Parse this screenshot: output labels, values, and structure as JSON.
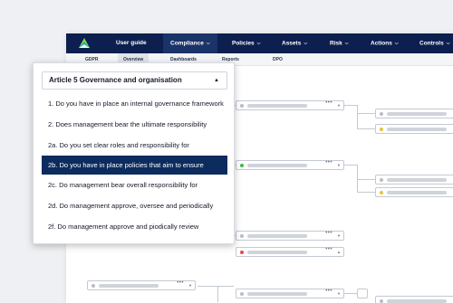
{
  "brand": {
    "logo_icon": "triangle-logo-icon",
    "colors": {
      "navbar": "#0c1f4e",
      "selected": "#0c2b5e",
      "green": "#3fb950",
      "yellow": "#e8c33a",
      "red": "#e5484d"
    }
  },
  "nav": {
    "items": [
      {
        "label": "User guide"
      },
      {
        "label": "Compliance"
      },
      {
        "label": "Policies"
      },
      {
        "label": "Assets"
      },
      {
        "label": "Risk"
      },
      {
        "label": "Actions"
      },
      {
        "label": "Controls"
      }
    ]
  },
  "subnav": {
    "items": [
      {
        "label": "GDPR"
      },
      {
        "label": "Overview"
      },
      {
        "label": "Dashboards"
      },
      {
        "label": "Reports"
      },
      {
        "label": "DPO"
      }
    ]
  },
  "dropdown": {
    "header": "Article 5 Governance and organisation",
    "items": [
      {
        "label": "1. Do you have in place an internal governance framework"
      },
      {
        "label": "2. Does management bear the ultimate responsibility"
      },
      {
        "label": "2a. Do you set clear roles and responsibility for"
      },
      {
        "label": "2b. Do you have in place policies that aim to ensure"
      },
      {
        "label": "2c. Do management bear overall responsibility for"
      },
      {
        "label": "2d. Do management approve, oversee and periodically"
      },
      {
        "label": "2f. Do management approve and piodically review"
      }
    ],
    "selected_index": 3
  }
}
